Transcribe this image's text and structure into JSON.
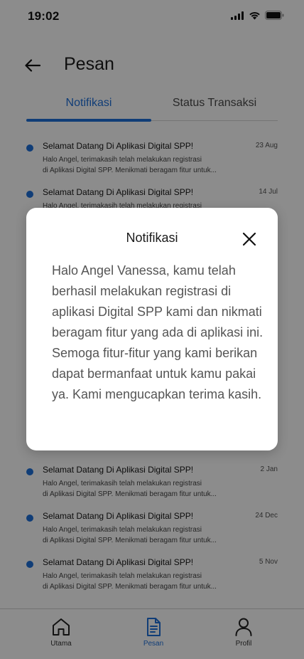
{
  "status_bar": {
    "time": "19:02"
  },
  "header": {
    "title": "Pesan"
  },
  "tabs": [
    {
      "label": "Notifikasi",
      "active": true
    },
    {
      "label": "Status Transaksi",
      "active": false
    }
  ],
  "notifications": [
    {
      "title": "Selamat Datang Di Aplikasi Digital SPP!",
      "date": "23 Aug",
      "body_line1": "Halo Angel, terimakasih telah melakukan registrasi",
      "body_line2": "di Aplikasi Digital SPP. Menikmati beragam fitur untuk..."
    },
    {
      "title": "Selamat Datang Di Aplikasi Digital SPP!",
      "date": "14 Jul",
      "body_line1": "Halo Angel, terimakasih telah melakukan registrasi",
      "body_line2": ""
    },
    {
      "title": "Selamat Datang Di Aplikasi Digital SPP!",
      "date": "2 Jan",
      "body_line1": "Halo Angel, terimakasih telah melakukan registrasi",
      "body_line2": "di Aplikasi Digital SPP. Menikmati beragam fitur untuk..."
    },
    {
      "title": "Selamat Datang Di Aplikasi Digital SPP!",
      "date": "24 Dec",
      "body_line1": "Halo Angel, terimakasih telah melakukan registrasi",
      "body_line2": "di Aplikasi Digital SPP. Menikmati beragam fitur untuk..."
    },
    {
      "title": "Selamat Datang Di Aplikasi Digital SPP!",
      "date": "5 Nov",
      "body_line1": "Halo Angel, terimakasih telah melakukan registrasi",
      "body_line2": "di Aplikasi Digital SPP. Menikmati beragam fitur untuk..."
    }
  ],
  "bottom_nav": [
    {
      "label": "Utama",
      "icon": "home-icon",
      "active": false
    },
    {
      "label": "Pesan",
      "icon": "document-icon",
      "active": true
    },
    {
      "label": "Profil",
      "icon": "user-icon",
      "active": false
    }
  ],
  "modal": {
    "title": "Notifikasi",
    "body": "Halo Angel Vanessa, kamu telah berhasil melakukan registrasi di aplikasi Digital SPP kami dan nikmati beragam fitur yang ada di aplikasi ini. Semoga fitur-fitur yang kami berikan dapat bermanfaat untuk kamu pakai ya. Kami mengucapkan terima kasih."
  },
  "colors": {
    "accent": "#1e6fd9",
    "overlay": "rgba(0,0,0,0.45)"
  }
}
